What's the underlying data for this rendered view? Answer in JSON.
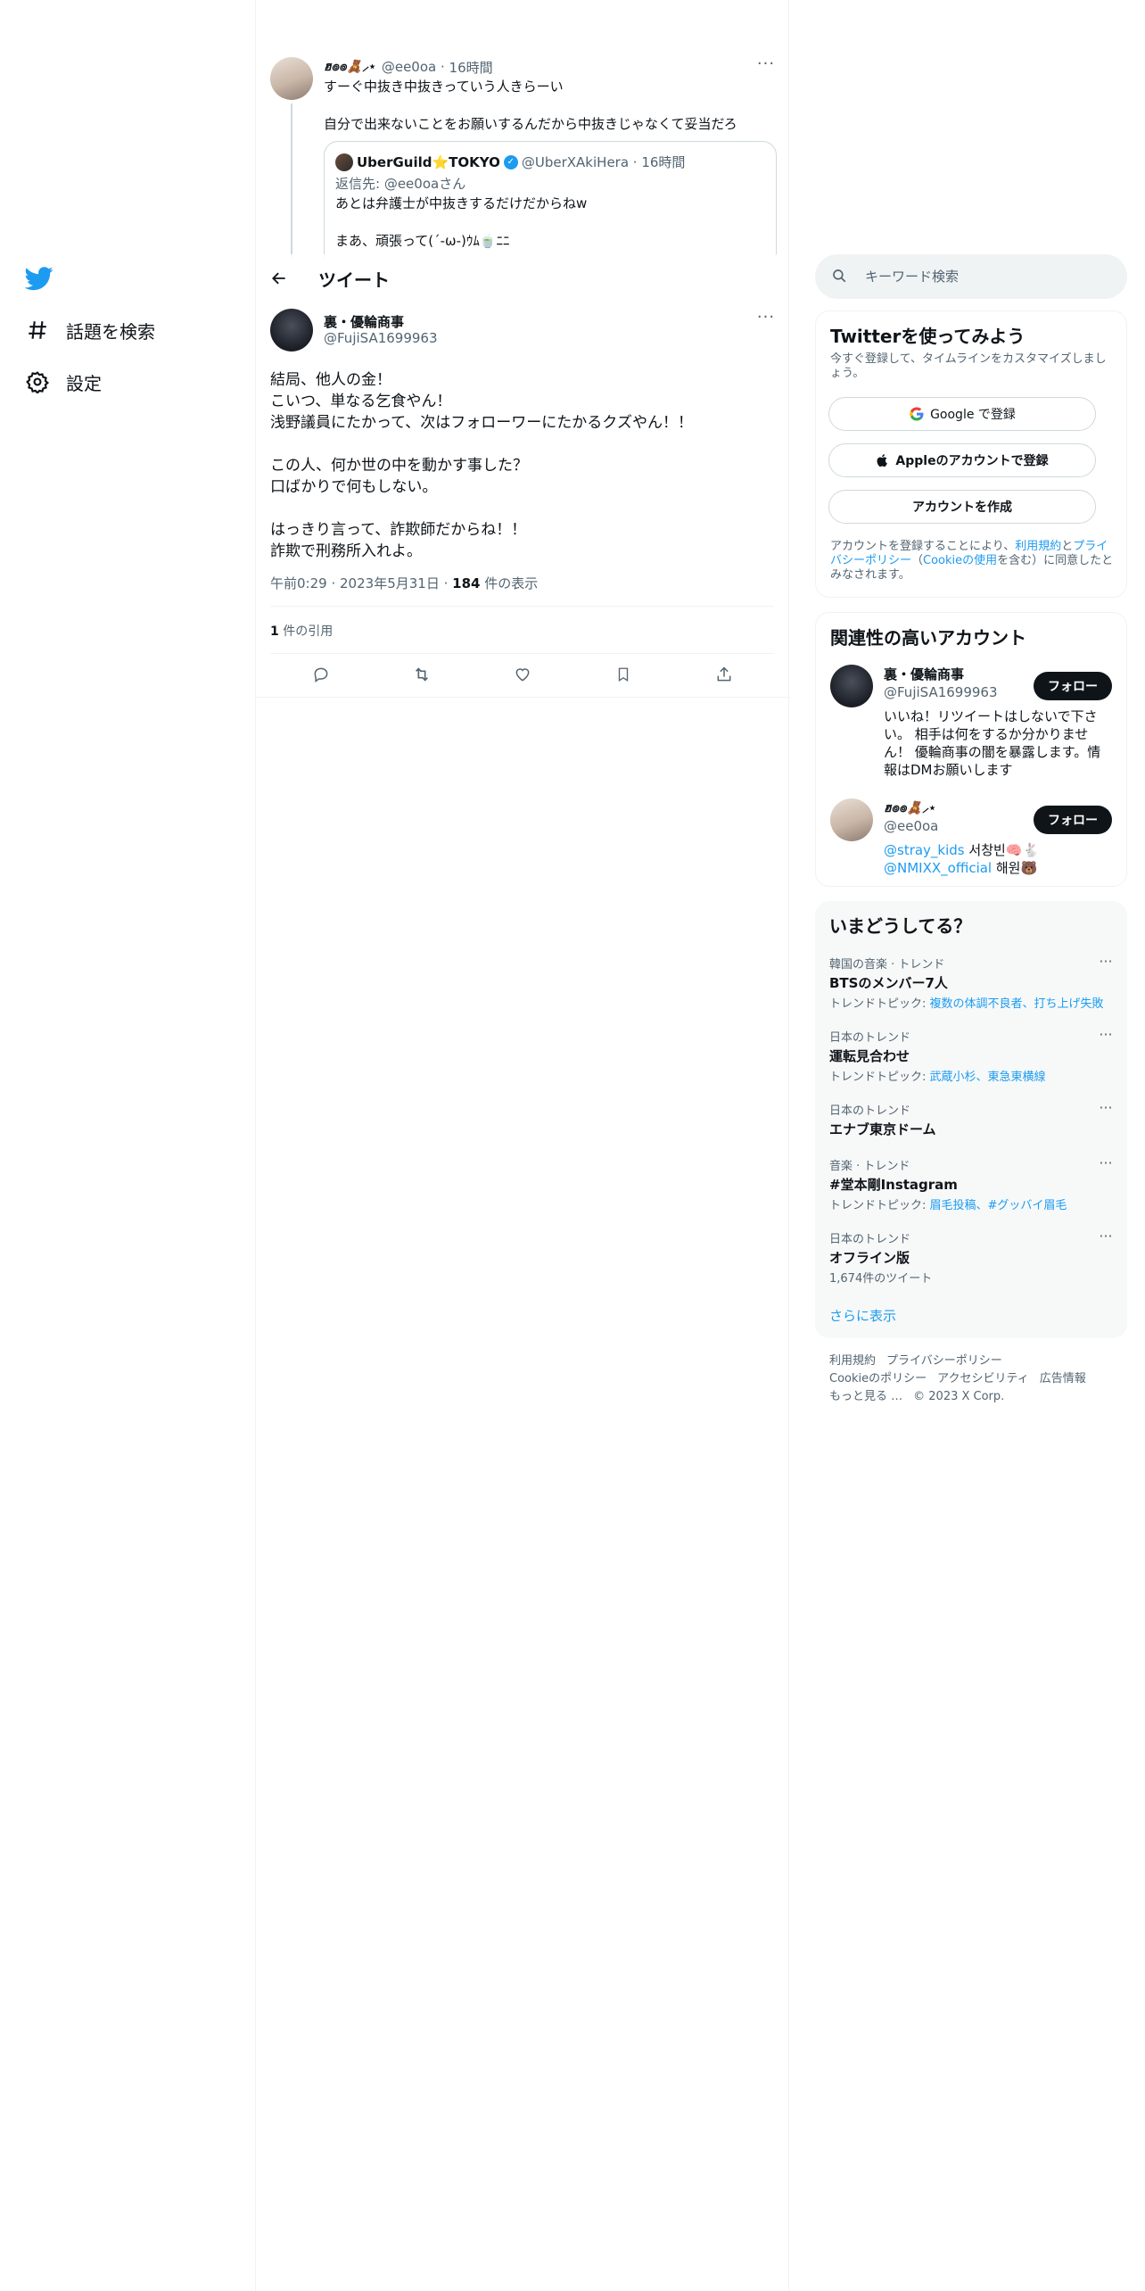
{
  "sidebar": {
    "nav": [
      {
        "label": "話題を検索",
        "icon": "hashtag-icon"
      },
      {
        "label": "設定",
        "icon": "gear-icon"
      }
    ]
  },
  "context_tweet": {
    "name": "ฮ๏๏🧸⸝⋆",
    "handle": "@ee0oa",
    "time": "16時間",
    "line1": "すーぐ中抜き中抜きっていう人きらーい",
    "line2": "自分で出来ないことをお願いするんだから中抜きじゃなくて妥当だろ",
    "quote": {
      "name": "UberGuild⭐TOKYO",
      "handle": "@UberXAkiHera",
      "time": "16時間",
      "reply_to": "返信先: @ee0oaさん",
      "line1": "あとは弁護士が中抜きするだけだからねw",
      "line2": "まあ、頑張って(´-ω-)ｳﾑ🍵ﾆﾆ"
    }
  },
  "header": {
    "title": "ツイート"
  },
  "tweet": {
    "name": "裏・優輪商事",
    "handle": "@FujiSA1699963",
    "body": [
      "結局、他人の金！",
      "こいつ、単なる乞食やん！",
      "浅野議員にたかって、次はフォローワーにたかるクズやん！！",
      "",
      "この人、何か世の中を動かす事した？",
      "口ばかりで何もしない。",
      "",
      "はっきり言って、詐欺師だからね！！",
      "詐欺で刑務所入れよ。"
    ],
    "time": "午前0:29",
    "date": "2023年5月31日",
    "views_count": "184",
    "views_label": " 件の表示",
    "quotes_count": "1",
    "quotes_label": " 件の引用"
  },
  "search": {
    "placeholder": "キーワード検索"
  },
  "signup": {
    "title": "Twitterを使ってみよう",
    "subtitle": "今すぐ登録して、タイムラインをカスタマイズしましょう。",
    "google": "Google で登録",
    "apple": "Appleのアカウントで登録",
    "create": "アカウントを作成",
    "legal_pre": "アカウントを登録することにより、",
    "legal_terms": "利用規約",
    "legal_mid": "と",
    "legal_privacy": "プライバシーポリシー",
    "legal_paren_open": "（",
    "legal_cookie": "Cookieの使用",
    "legal_post": "を含む）に同意したとみなされます。"
  },
  "related": {
    "title": "関連性の高いアカウント",
    "accounts": [
      {
        "name": "裏・優輪商事",
        "handle": "@FujiSA1699963",
        "bio": "いいね！リツイートはしないで下さい。 相手は何をするか分かりません！ 優輪商事の闇を暴露します。情報はDMお願いします",
        "follow": "フォロー"
      },
      {
        "name": "ฮ๏๏🧸⸝⋆",
        "handle": "@ee0oa",
        "bio_link1": "@stray_kids",
        "bio_text1": " 서창빈🧠🐇",
        "bio_link2": "@NMIXX_official",
        "bio_text2": " 해원🐻",
        "follow": "フォロー"
      }
    ]
  },
  "trends": {
    "title": "いまどうしてる？",
    "items": [
      {
        "context": "韓国の音楽 · トレンド",
        "title": "BTSのメンバー7人",
        "sub_prefix": "トレンドトピック: ",
        "sub_links": "複数の体調不良者、打ち上げ失敗"
      },
      {
        "context": "日本のトレンド",
        "title": "運転見合わせ",
        "sub_prefix": "トレンドトピック: ",
        "sub_links": "武蔵小杉、東急東横線"
      },
      {
        "context": "日本のトレンド",
        "title": "エナブ東京ドーム",
        "sub_prefix": "",
        "sub_links": ""
      },
      {
        "context": "音楽 · トレンド",
        "title": "#堂本剛Instagram",
        "sub_prefix": "トレンドトピック: ",
        "sub_links": "眉毛投稿、#グッバイ眉毛"
      },
      {
        "context": "日本のトレンド",
        "title": "オフライン版",
        "sub_prefix": "1,674件のツイート",
        "sub_links": ""
      }
    ],
    "show_more": "さらに表示"
  },
  "footer": {
    "row1": [
      "利用規約",
      "プライバシーポリシー"
    ],
    "row2": [
      "Cookieのポリシー",
      "アクセシビリティ",
      "広告情報"
    ],
    "row3": [
      "もっと見る …",
      "© 2023 X Corp."
    ]
  },
  "colors": {
    "accent": "#1d9bf0",
    "text": "#0f1419",
    "muted": "#536471",
    "border": "#eff3f4"
  }
}
